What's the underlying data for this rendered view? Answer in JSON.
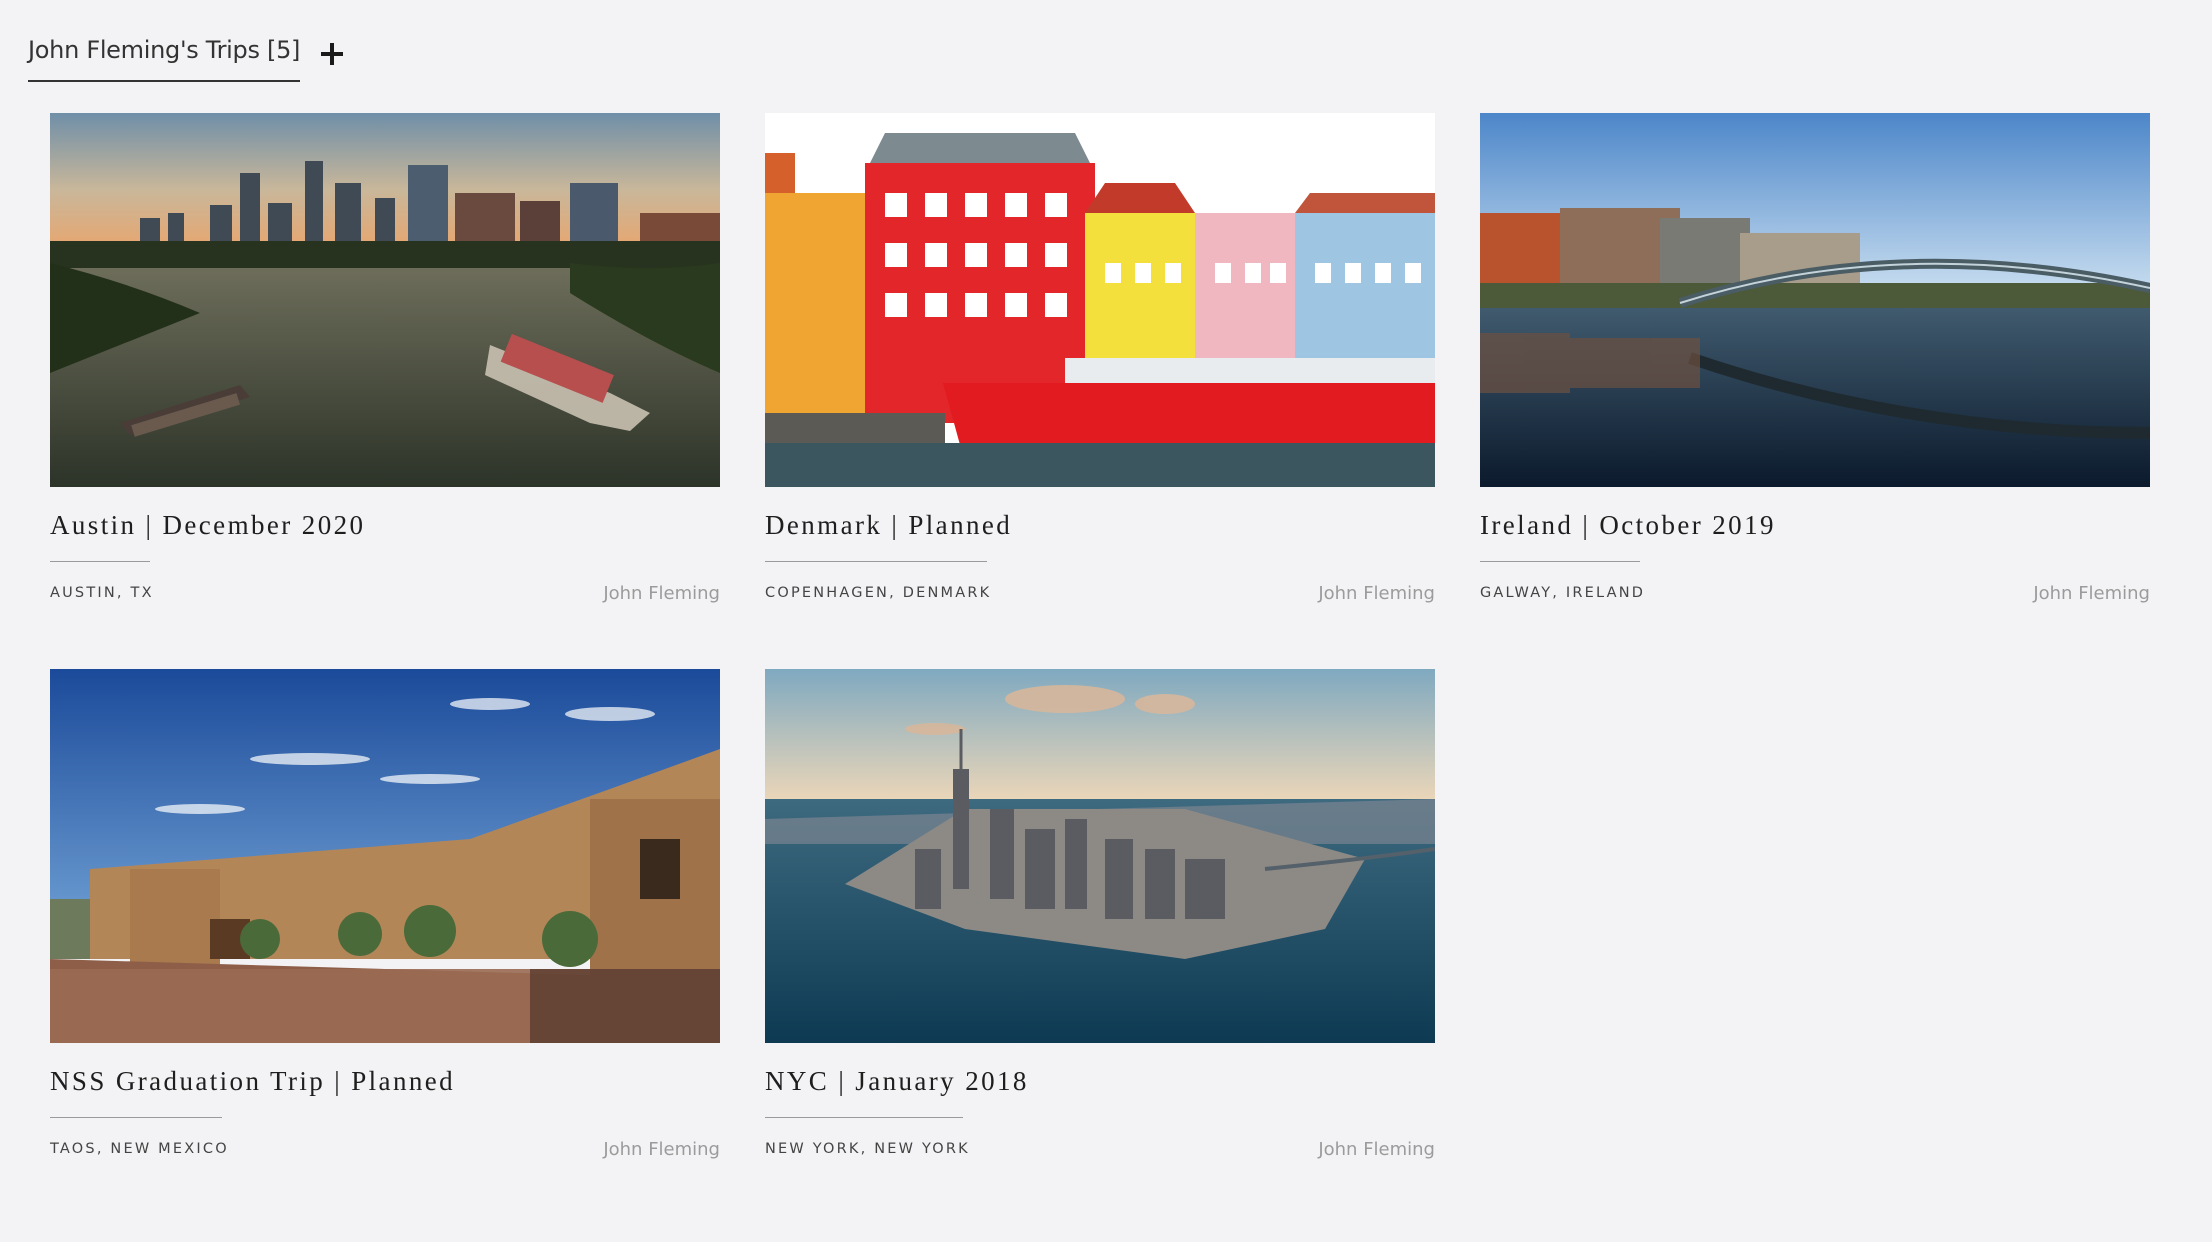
{
  "header": {
    "tab_label": "John Fleming's Trips [5]",
    "add_icon": "plus-icon"
  },
  "trips": [
    {
      "title": "Austin  |  December 2020",
      "location": "AUSTIN, TX",
      "owner": "John Fleming",
      "image": "austin-skyline-river-photo"
    },
    {
      "title": "Denmark  |  Planned",
      "location": "COPENHAGEN, DENMARK",
      "owner": "John Fleming",
      "image": "copenhagen-nyhavn-houses-photo"
    },
    {
      "title": "Ireland  |  October 2019",
      "location": "GALWAY, IRELAND",
      "owner": "John Fleming",
      "image": "dublin-bridge-river-photo"
    },
    {
      "title": "NSS Graduation Trip  |  Planned",
      "location": "TAOS, NEW MEXICO",
      "owner": "John Fleming",
      "image": "adobe-house-photo"
    },
    {
      "title": "NYC  |  January 2018",
      "location": "NEW YORK, NEW YORK",
      "owner": "John Fleming",
      "image": "manhattan-aerial-photo"
    }
  ]
}
